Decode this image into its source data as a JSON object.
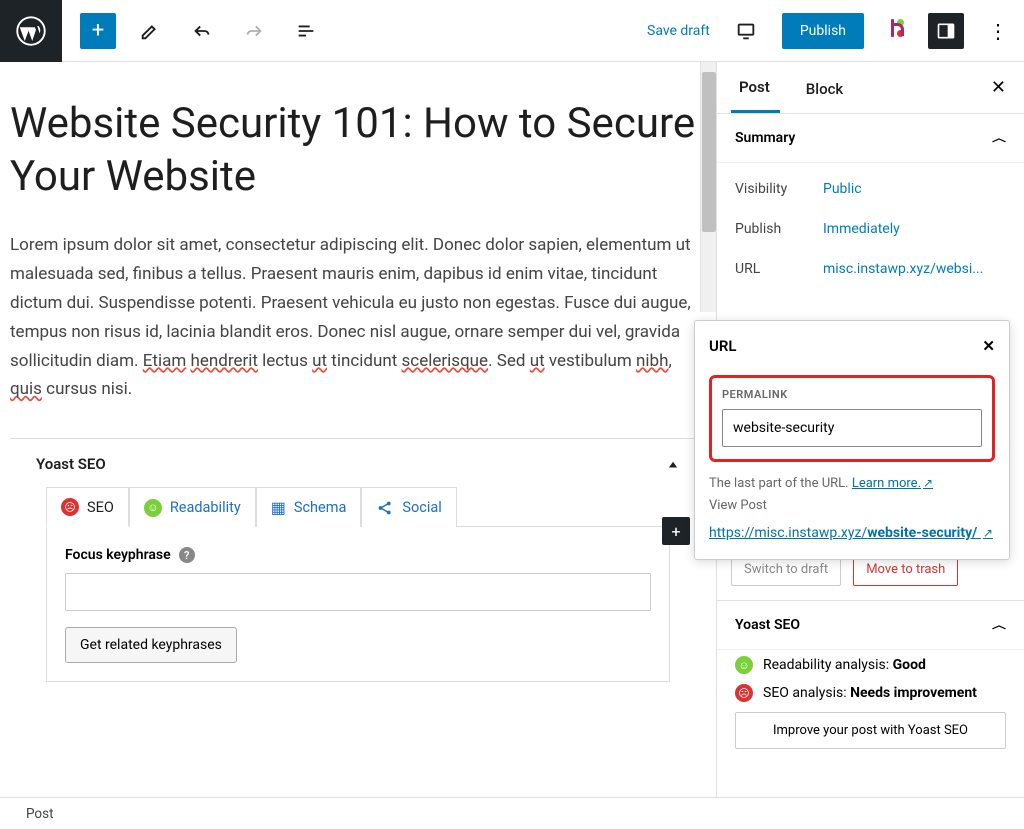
{
  "toolbar": {
    "save_draft": "Save draft",
    "publish": "Publish"
  },
  "post": {
    "title": "Website Security 101: How to Secure Your Website",
    "body_parts": {
      "p1": "Lorem ipsum dolor sit amet, consectetur adipiscing elit. Donec dolor sapien, elementum ut malesuada sed, finibus a tellus. Praesent mauris enim, dapibus id enim vitae, tincidunt dictum dui. Suspendisse potenti. Praesent vehicula eu justo non egestas. Fusce dui augue, tempus non risus id, lacinia blandit eros. Donec nisl augue, ornare semper dui vel, gravida sollicitudin diam. ",
      "sp1": "Etiam",
      "sp2": "hendrerit",
      "sp3": " lectus ",
      "sp4": "ut",
      "sp5": " tincidunt ",
      "sp6": "scelerisque",
      "p2": ". Sed ",
      "sp7": "ut",
      "p3": " vestibulum ",
      "sp8": "nibh",
      "p4": ", ",
      "sp9": "quis",
      "p5": " cursus nisi."
    }
  },
  "yoast": {
    "panel_title": "Yoast SEO",
    "tabs": {
      "seo": "SEO",
      "readability": "Readability",
      "schema": "Schema",
      "social": "Social"
    },
    "focus_keyphrase_label": "Focus keyphrase",
    "related_button": "Get related keyphrases"
  },
  "sidebar": {
    "tabs": {
      "post": "Post",
      "block": "Block"
    },
    "summary": {
      "title": "Summary",
      "visibility": {
        "label": "Visibility",
        "value": "Public"
      },
      "publish": {
        "label": "Publish",
        "value": "Immediately"
      },
      "url": {
        "label": "URL",
        "value": "misc.instawp.xyz/websi..."
      }
    },
    "switch_draft": "Switch to draft",
    "trash": "Move to trash",
    "yoast": {
      "title": "Yoast SEO",
      "readability": {
        "label": "Readability analysis: ",
        "value": "Good"
      },
      "seo": {
        "label": "SEO analysis: ",
        "value": "Needs improvement"
      },
      "improve": "Improve your post with Yoast SEO"
    }
  },
  "url_popover": {
    "title": "URL",
    "permalink_label": "PERMALINK",
    "permalink_value": "website-security",
    "help_text": "The last part of the URL. ",
    "learn_more": "Learn more.",
    "view_post": "View Post",
    "url_prefix": "https://misc.instawp.xyz/",
    "url_slug": "website-security/"
  },
  "footer": {
    "breadcrumb": "Post"
  }
}
